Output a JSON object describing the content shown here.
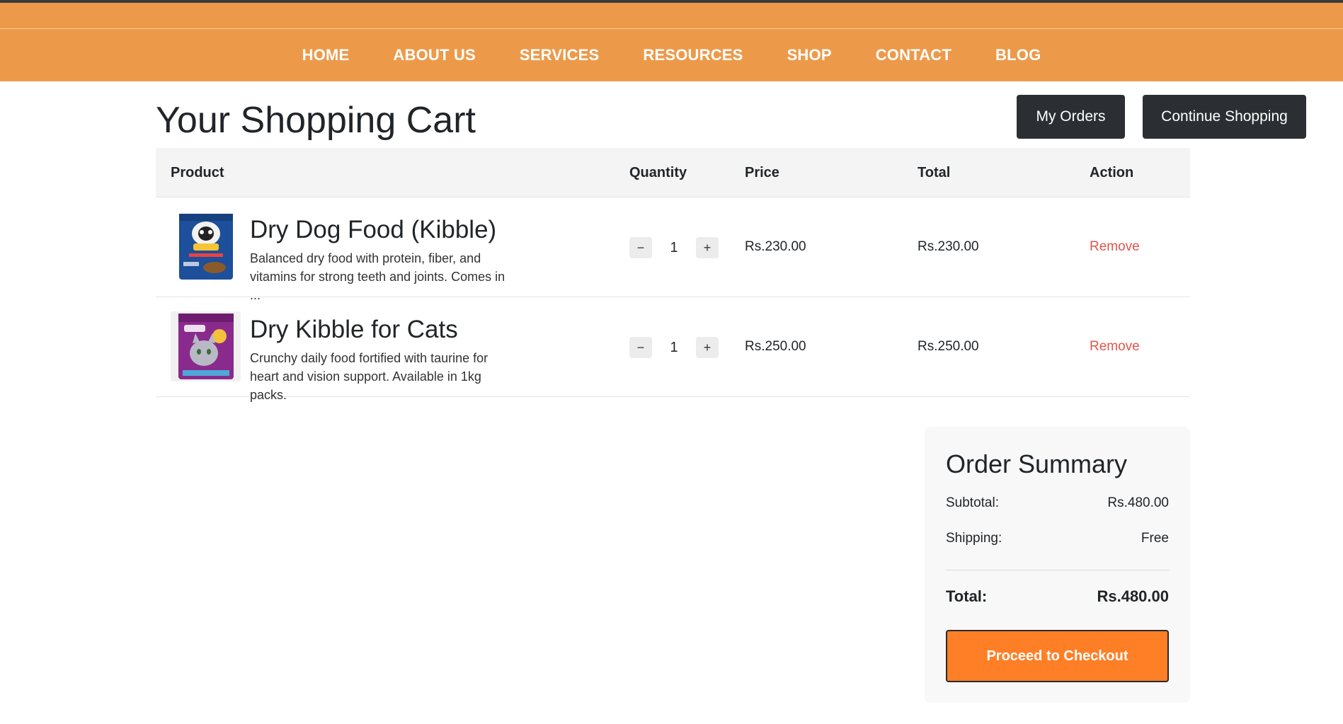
{
  "nav": {
    "items": [
      "HOME",
      "ABOUT US",
      "SERVICES",
      "RESOURCES",
      "SHOP",
      "CONTACT",
      "BLOG"
    ]
  },
  "page": {
    "title": "Your Shopping Cart",
    "my_orders": "My Orders",
    "continue_shopping": "Continue Shopping"
  },
  "table": {
    "headers": {
      "product": "Product",
      "quantity": "Quantity",
      "price": "Price",
      "total": "Total",
      "action": "Action"
    },
    "rows": [
      {
        "name": "Dry Dog Food (Kibble)",
        "description": "Balanced dry food with protein, fiber, and vitamins for strong teeth and joints. Comes in ...",
        "qty": "1",
        "price": "Rs.230.00",
        "total": "Rs.230.00",
        "action": "Remove",
        "minus": "−",
        "plus": "+"
      },
      {
        "name": "Dry Kibble for Cats",
        "description": "Crunchy daily food fortified with taurine for heart and vision support. Available in 1kg packs.",
        "qty": "1",
        "price": "Rs.250.00",
        "total": "Rs.250.00",
        "action": "Remove",
        "minus": "−",
        "plus": "+"
      }
    ]
  },
  "summary": {
    "title": "Order Summary",
    "subtotal_label": "Subtotal:",
    "subtotal_value": "Rs.480.00",
    "shipping_label": "Shipping:",
    "shipping_value": "Free",
    "total_label": "Total:",
    "total_value": "Rs.480.00",
    "checkout": "Proceed to Checkout"
  },
  "colors": {
    "header": "#ec9a4a",
    "checkout": "#ff7f27",
    "remove": "#e0554d",
    "dark_button": "#2b2f33"
  }
}
